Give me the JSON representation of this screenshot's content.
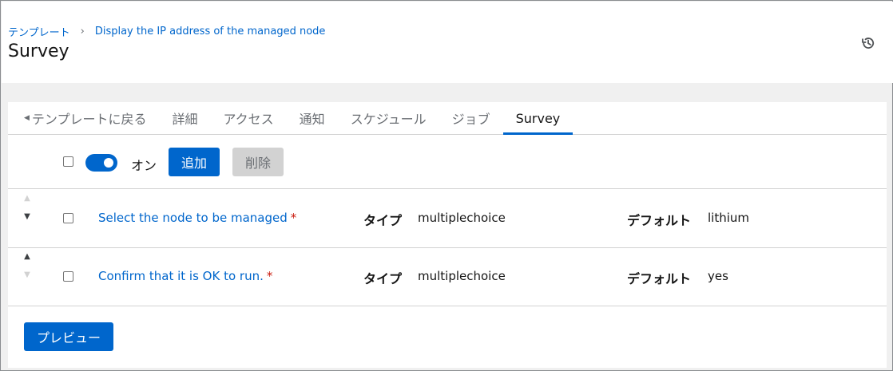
{
  "breadcrumb": {
    "parent": "テンプレート",
    "separator": "›",
    "current": "Display the IP address of the managed node"
  },
  "page": {
    "title": "Survey",
    "history_icon": "history-icon"
  },
  "tabs": [
    {
      "label": "テンプレートに戻る",
      "icon": "caret-left-icon"
    },
    {
      "label": "詳細"
    },
    {
      "label": "アクセス"
    },
    {
      "label": "通知"
    },
    {
      "label": "スケジュール"
    },
    {
      "label": "ジョブ"
    },
    {
      "label": "Survey",
      "active": true
    }
  ],
  "toolbar": {
    "toggle_label": "オン",
    "toggle_on": true,
    "add_label": "追加",
    "delete_label": "削除"
  },
  "questions": [
    {
      "name": "Select the node to be managed",
      "required_mark": "*",
      "type_label": "タイプ",
      "type_value": "multiplechoice",
      "default_label": "デフォルト",
      "default_value": "lithium"
    },
    {
      "name": "Confirm that it is OK to run.",
      "required_mark": "*",
      "type_label": "タイプ",
      "type_value": "multiplechoice",
      "default_label": "デフォルト",
      "default_value": "yes"
    }
  ],
  "footer": {
    "preview_label": "プレビュー"
  },
  "colors": {
    "accent": "#0066cc",
    "required": "#c9190b",
    "disabled": "#d2d2d2"
  }
}
